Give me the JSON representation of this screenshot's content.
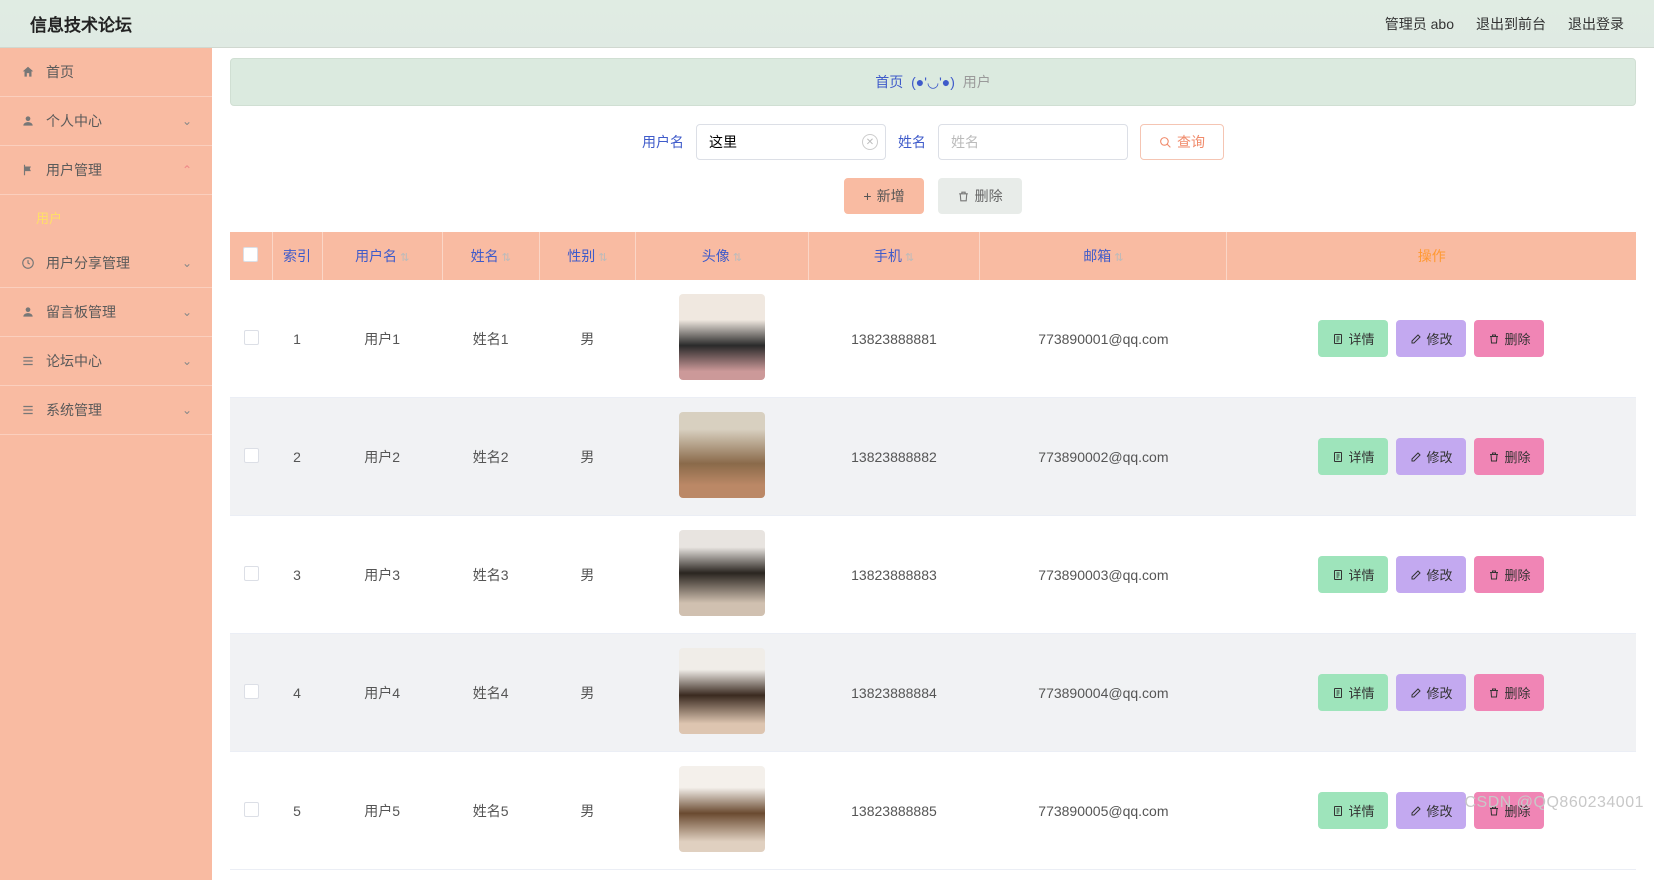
{
  "header": {
    "title": "信息技术论坛",
    "admin": "管理员 abo",
    "to_front": "退出到前台",
    "logout": "退出登录"
  },
  "sidebar": {
    "home": "首页",
    "profile": "个人中心",
    "user_mgmt": "用户管理",
    "user_sub": "用户",
    "share_mgmt": "用户分享管理",
    "board_mgmt": "留言板管理",
    "forum": "论坛中心",
    "system": "系统管理"
  },
  "breadcrumb": {
    "home": "首页",
    "face": "(●'◡'●)",
    "current": "用户"
  },
  "search": {
    "username_label": "用户名",
    "username_value": "这里",
    "name_label": "姓名",
    "name_placeholder": "姓名",
    "btn": "查询"
  },
  "actions": {
    "add": "新增",
    "delete": "删除"
  },
  "table": {
    "headers": {
      "index": "索引",
      "username": "用户名",
      "name": "姓名",
      "gender": "性别",
      "avatar": "头像",
      "phone": "手机",
      "email": "邮箱",
      "ops": "操作"
    },
    "op_labels": {
      "detail": "详情",
      "edit": "修改",
      "delete": "删除"
    },
    "rows": [
      {
        "idx": "1",
        "username": "用户1",
        "name": "姓名1",
        "gender": "男",
        "phone": "13823888881",
        "email": "773890001@qq.com"
      },
      {
        "idx": "2",
        "username": "用户2",
        "name": "姓名2",
        "gender": "男",
        "phone": "13823888882",
        "email": "773890002@qq.com"
      },
      {
        "idx": "3",
        "username": "用户3",
        "name": "姓名3",
        "gender": "男",
        "phone": "13823888883",
        "email": "773890003@qq.com"
      },
      {
        "idx": "4",
        "username": "用户4",
        "name": "姓名4",
        "gender": "男",
        "phone": "13823888884",
        "email": "773890004@qq.com"
      },
      {
        "idx": "5",
        "username": "用户5",
        "name": "姓名5",
        "gender": "男",
        "phone": "13823888885",
        "email": "773890005@qq.com"
      }
    ]
  },
  "watermark": "CSDN @QQ860234001"
}
